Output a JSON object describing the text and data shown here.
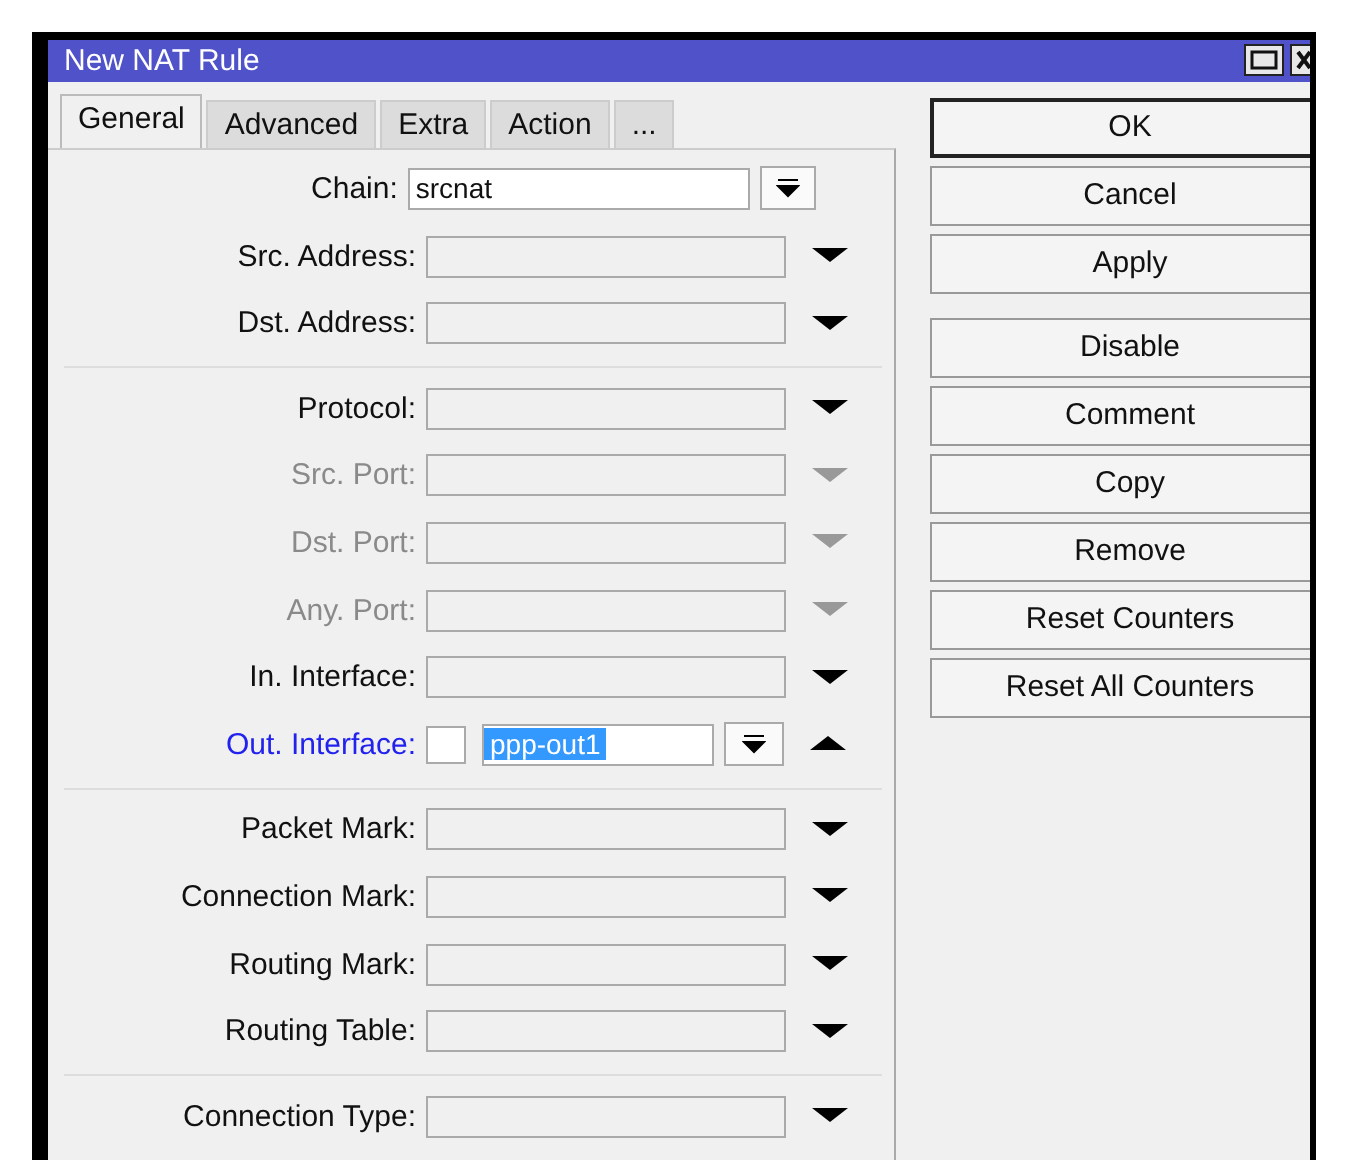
{
  "window": {
    "title": "New NAT Rule"
  },
  "tabs": [
    {
      "label": "General",
      "selected": true
    },
    {
      "label": "Advanced",
      "selected": false
    },
    {
      "label": "Extra",
      "selected": false
    },
    {
      "label": "Action",
      "selected": false
    },
    {
      "label": "...",
      "selected": false
    }
  ],
  "sections": [
    [
      {
        "label": "Chain:",
        "kind": "combo",
        "value": "srcnat",
        "disabled": false,
        "active": false,
        "expanded": false
      },
      {
        "label": "Src. Address:",
        "kind": "dropdown",
        "disabled": false,
        "active": false,
        "expanded": false
      },
      {
        "label": "Dst. Address:",
        "kind": "dropdown",
        "disabled": false,
        "active": false,
        "expanded": false
      }
    ],
    [
      {
        "label": "Protocol:",
        "kind": "dropdown",
        "disabled": false,
        "active": false,
        "expanded": false
      },
      {
        "label": "Src. Port:",
        "kind": "dropdown",
        "disabled": true,
        "active": false,
        "expanded": false
      },
      {
        "label": "Dst. Port:",
        "kind": "dropdown",
        "disabled": true,
        "active": false,
        "expanded": false
      },
      {
        "label": "Any. Port:",
        "kind": "dropdown",
        "disabled": true,
        "active": false,
        "expanded": false
      },
      {
        "label": "In. Interface:",
        "kind": "dropdown",
        "disabled": false,
        "active": false,
        "expanded": false
      },
      {
        "label": "Out. Interface:",
        "kind": "negatable",
        "value": "ppp-out1",
        "negated": false,
        "value_selected": true,
        "disabled": false,
        "active": true,
        "expanded": true
      }
    ],
    [
      {
        "label": "Packet Mark:",
        "kind": "dropdown",
        "disabled": false,
        "active": false,
        "expanded": false
      },
      {
        "label": "Connection Mark:",
        "kind": "dropdown",
        "disabled": false,
        "active": false,
        "expanded": false
      },
      {
        "label": "Routing Mark:",
        "kind": "dropdown",
        "disabled": false,
        "active": false,
        "expanded": false
      },
      {
        "label": "Routing Table:",
        "kind": "dropdown",
        "disabled": false,
        "active": false,
        "expanded": false
      }
    ],
    [
      {
        "label": "Connection Type:",
        "kind": "dropdown",
        "disabled": false,
        "active": false,
        "expanded": false
      }
    ]
  ],
  "button_groups": [
    [
      {
        "label": "OK",
        "default": true
      },
      {
        "label": "Cancel",
        "default": false
      },
      {
        "label": "Apply",
        "default": false
      }
    ],
    [
      {
        "label": "Disable",
        "default": false
      },
      {
        "label": "Comment",
        "default": false
      },
      {
        "label": "Copy",
        "default": false
      },
      {
        "label": "Remove",
        "default": false
      },
      {
        "label": "Reset Counters",
        "default": false
      },
      {
        "label": "Reset All Counters",
        "default": false
      }
    ]
  ]
}
